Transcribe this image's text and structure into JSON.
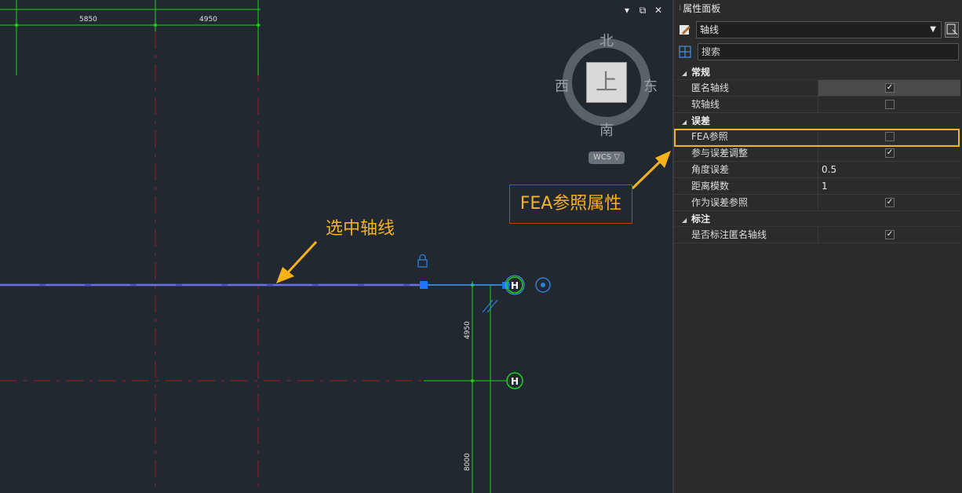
{
  "canvas": {
    "dimensions": {
      "top_left": "5850",
      "top_right": "4950",
      "vertical_1": "4950",
      "vertical_2": "8000"
    },
    "compass": {
      "north": "北",
      "south": "南",
      "west": "西",
      "east": "东",
      "face": "上",
      "wcs": "WCS ▽"
    },
    "annotations": {
      "selected_axis": "选中轴线",
      "fea_callout": "FEA参照属性"
    },
    "axis_tag": "H",
    "window_controls": {
      "pin": "▾",
      "restore": "⧉",
      "close": "✕"
    },
    "colors": {
      "background": "#212830",
      "grid_green": "#19d419",
      "grid_red": "#8a1a24",
      "selected_line": "#4a4fc4",
      "accent": "#f5b21a"
    }
  },
  "panel": {
    "title": "属性面板",
    "object_type": "轴线",
    "search_placeholder": "搜索",
    "categories": [
      {
        "name": "常规",
        "props": [
          {
            "name": "匿名轴线",
            "value": "",
            "checked": true
          },
          {
            "name": "软轴线",
            "value": "",
            "checked": false
          }
        ]
      },
      {
        "name": "误差",
        "props": [
          {
            "name": "FEA参照",
            "value": "",
            "checked": false
          },
          {
            "name": "参与误差调整",
            "value": "",
            "checked": true
          },
          {
            "name": "角度误差",
            "value": "0.5"
          },
          {
            "name": "距离模数",
            "value": "1"
          },
          {
            "name": "作为误差参照",
            "value": "",
            "checked": true
          }
        ]
      },
      {
        "name": "标注",
        "props": [
          {
            "name": "是否标注匿名轴线",
            "value": "",
            "checked": true
          }
        ]
      }
    ]
  }
}
